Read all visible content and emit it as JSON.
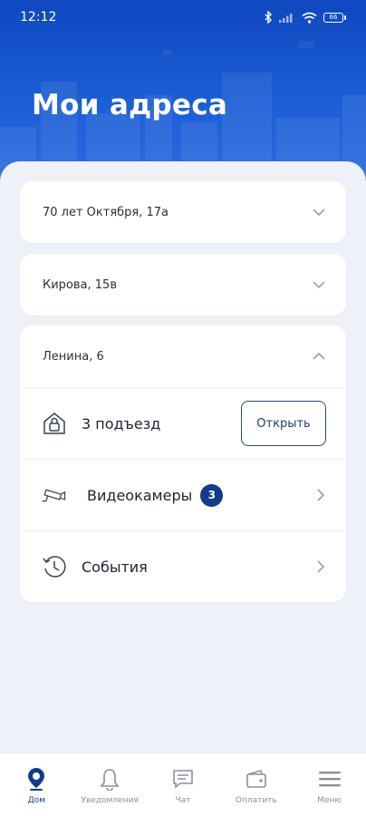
{
  "status_bar": {
    "time": "12:12",
    "battery": "66"
  },
  "page_title": "Мои адреса",
  "addresses": [
    {
      "label": "70 лет Октября, 17а",
      "expanded": false
    },
    {
      "label": "Кирова, 15в",
      "expanded": false
    },
    {
      "label": "Ленина, 6",
      "expanded": true
    }
  ],
  "expanded_address": {
    "entrance": {
      "label": "3 подъезд",
      "button_label": "Открыть"
    },
    "cameras": {
      "label": "Видеокамеры",
      "count": "3"
    },
    "events": {
      "label": "События"
    }
  },
  "bottom_nav": [
    {
      "label": "Дом",
      "icon": "home-pin-icon",
      "active": true
    },
    {
      "label": "Уведомления",
      "icon": "bell-icon",
      "active": false
    },
    {
      "label": "Чат",
      "icon": "chat-icon",
      "active": false
    },
    {
      "label": "Оплатить",
      "icon": "wallet-icon",
      "active": false
    },
    {
      "label": "Меню",
      "icon": "menu-icon",
      "active": false
    }
  ],
  "colors": {
    "header": "#1d5fd6",
    "accent": "#143a8a",
    "background": "#eef1f8"
  }
}
